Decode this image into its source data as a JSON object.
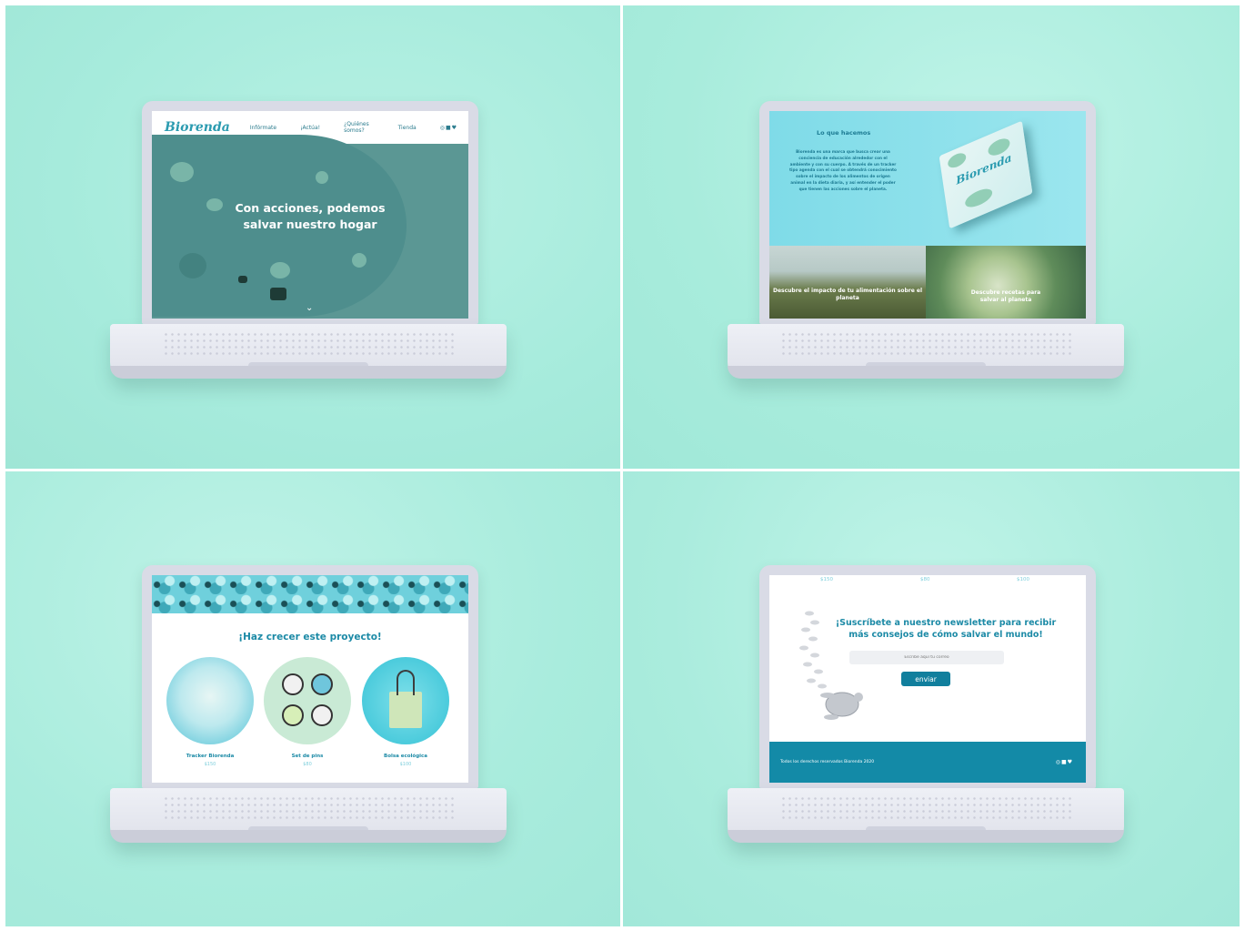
{
  "screen1": {
    "logo": "Biorenda",
    "nav": [
      "Infórmate",
      "¡Actúa!",
      "¿Quiénes somos?",
      "Tienda"
    ],
    "social": "◎■♥",
    "hero_title_line1": "Con acciones, podemos",
    "hero_title_line2": "salvar nuestro hogar",
    "chevron": "⌄"
  },
  "screen2": {
    "heading": "Lo que hacemos",
    "body": "Biorenda es una marca que busca crear una conciencia de educación alrededor con el ambiente y con su cuerpo. A través de un tracker tipo agenda con el cual se obtendrá conocimiento sobre el impacto de los alimentos de origen animal en la dieta diaria, y así entender el poder que tienen las acciones sobre el planeta.",
    "book_logo": "Biorenda",
    "tile_left": "Descubre el impacto de tu alimentación sobre el planeta",
    "tile_right": "Descubre recetas para salvar al planeta"
  },
  "screen3": {
    "title": "¡Haz crecer este proyecto!",
    "products": [
      {
        "name": "Tracker Biorenda",
        "price": "$150"
      },
      {
        "name": "Set de pins",
        "price": "$80"
      },
      {
        "name": "Bolsa ecológica",
        "price": "$100"
      }
    ]
  },
  "screen4": {
    "top_prices": [
      "$150",
      "$80",
      "$100"
    ],
    "title_line1": "¡Suscríbete a nuestro newsletter para recibir",
    "title_line2": "más consejos de cómo salvar el mundo!",
    "input_placeholder": "Escribe aquí tu correo",
    "button_label": "enviar",
    "footer_text": "Todos los derechos reservados Biorenda 2020",
    "footer_social": "◎■♥"
  },
  "colors": {
    "background": "#a8ecdc",
    "brand_teal": "#1c8aa6",
    "footer": "#138aa7"
  }
}
